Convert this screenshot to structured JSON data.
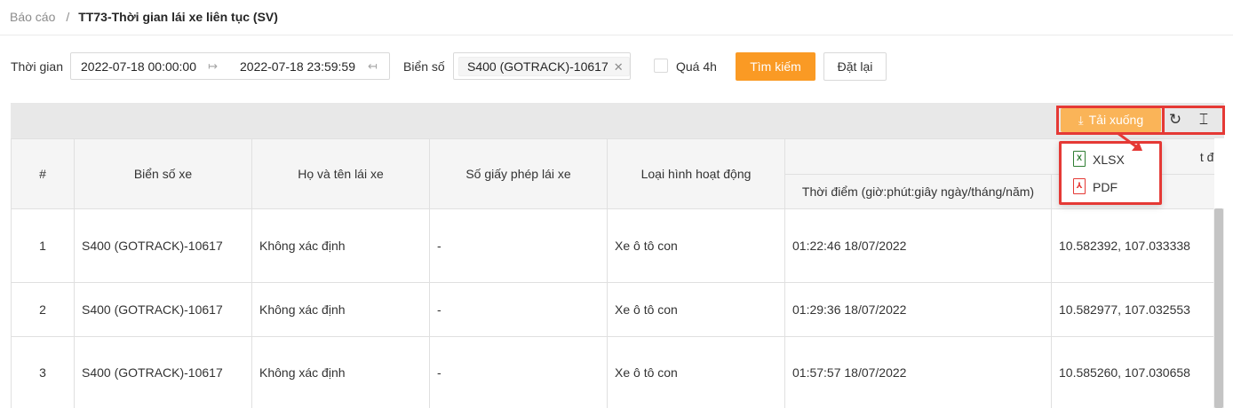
{
  "breadcrumb": {
    "root": "Báo cáo",
    "separator": "/",
    "current": "TT73-Thời gian lái xe liên tục (SV)"
  },
  "filters": {
    "time_label": "Thời gian",
    "time_from": "2022-07-18 00:00:00",
    "time_to": "2022-07-18 23:59:59",
    "plate_label": "Biển số",
    "plate_tag": "S400 (GOTRACK)-10617",
    "over4h_label": "Quá 4h",
    "over4h_checked": false,
    "search_button": "Tìm kiếm",
    "reset_button": "Đặt lại"
  },
  "toolbar": {
    "download_label": "Tải xuống",
    "download_menu": [
      {
        "label": "XLSX",
        "icon": "xlsx-file-icon"
      },
      {
        "label": "PDF",
        "icon": "pdf-file-icon"
      }
    ],
    "refresh_icon": "refresh-icon",
    "row_height_icon": "row-height-icon"
  },
  "table": {
    "headers": {
      "index": "#",
      "plate": "Biển số xe",
      "driver": "Họ và tên lái xe",
      "license": "Số giấy phép lái xe",
      "activity": "Loại hình hoạt động",
      "start_group_partial": "t đầu",
      "start_time": "Thời điểm (giờ:phút:giây ngày/tháng/năm)"
    },
    "rows": [
      {
        "index": "1",
        "plate": "S400 (GOTRACK)-10617",
        "driver": "Không xác định",
        "license": "-",
        "activity": "Xe ô tô con",
        "time": "01:22:46 18/07/2022",
        "coords": "10.582392, 107.033338"
      },
      {
        "index": "2",
        "plate": "S400 (GOTRACK)-10617",
        "driver": "Không xác định",
        "license": "-",
        "activity": "Xe ô tô con",
        "time": "01:29:36 18/07/2022",
        "coords": "10.582977, 107.032553"
      },
      {
        "index": "3",
        "plate": "S400 (GOTRACK)-10617",
        "driver": "Không xác định",
        "license": "-",
        "activity": "Xe ô tô con",
        "time": "01:57:57 18/07/2022",
        "coords": "10.585260, 107.030658"
      }
    ]
  },
  "colors": {
    "accent": "#fa9a24",
    "highlight": "#e53935"
  }
}
